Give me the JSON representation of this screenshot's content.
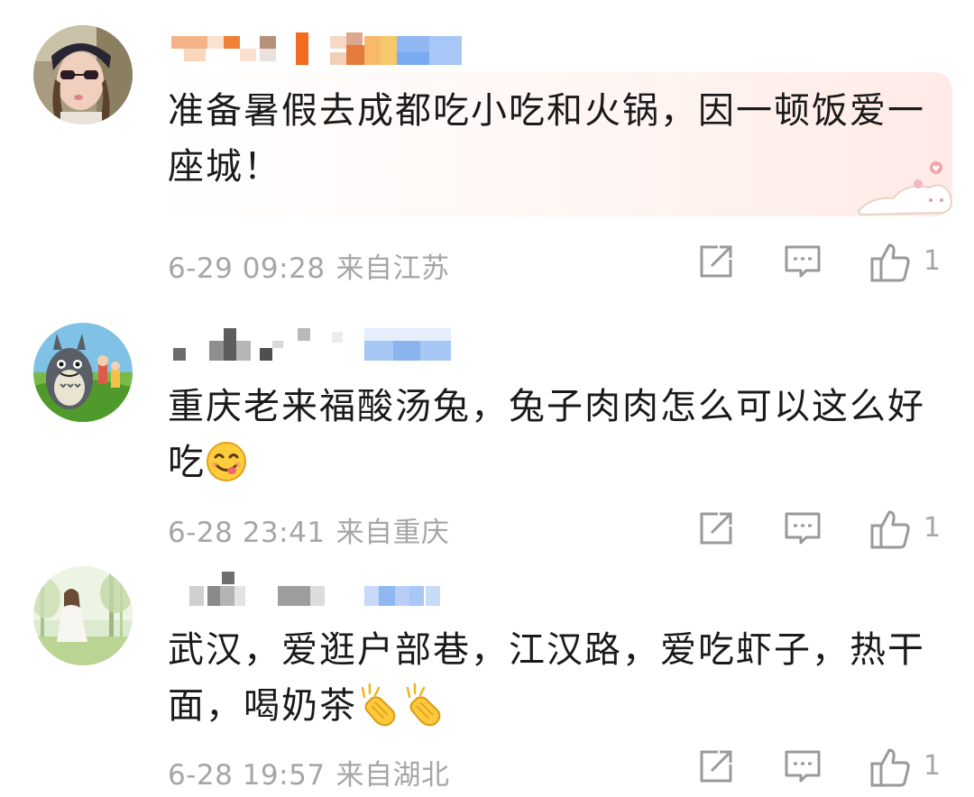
{
  "comments": [
    {
      "text_line1": "准备暑假去成都吃小吃和火锅，因一顿饭爱一",
      "text_line2": "座城！",
      "date": "6-29 09:28",
      "location": "来自江苏",
      "likes": "1",
      "avatar": "woman-sunglasses-avatar"
    },
    {
      "text_line1": "重庆老来福酸汤兔，兔子肉肉怎么可以这么好",
      "text_line2": "吃",
      "date": "6-28 23:41",
      "location": "来自重庆",
      "likes": "1",
      "avatar": "totoro-avatar",
      "emoji": "yum-face-emoji"
    },
    {
      "text_line1": "武汉，爱逛户部巷，江汉路，爱吃虾子，热干",
      "text_line2": "面，喝奶茶",
      "date": "6-28 19:57",
      "location": "来自湖北",
      "likes": "1",
      "avatar": "forest-girl-avatar",
      "emoji": "clapping-hands-emoji"
    }
  ],
  "icons": {
    "share": "share-icon",
    "comment": "comment-icon",
    "like": "thumbs-up-icon"
  },
  "colors": {
    "text": "#1a1a1a",
    "meta": "#a6a6a6",
    "bubble": "#ffeae6"
  }
}
